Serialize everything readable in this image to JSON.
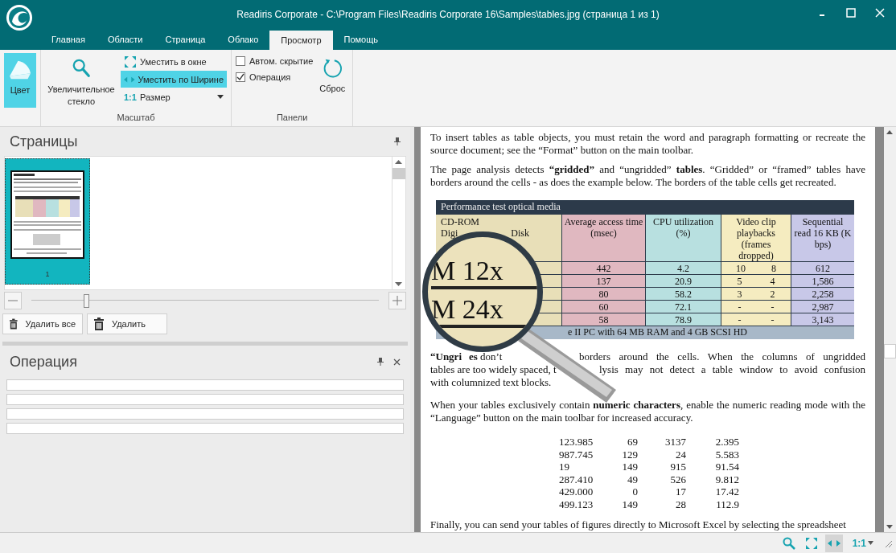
{
  "window": {
    "title": "Readiris Corporate - C:\\Program Files\\Readiris Corporate 16\\Samples\\tables.jpg (страница 1 из 1)"
  },
  "tabs": [
    {
      "label": "Главная",
      "selected": false
    },
    {
      "label": "Области",
      "selected": false
    },
    {
      "label": "Страница",
      "selected": false
    },
    {
      "label": "Облако",
      "selected": false
    },
    {
      "label": "Просмотр",
      "selected": true
    },
    {
      "label": "Помощь",
      "selected": false
    }
  ],
  "ribbon": {
    "color_button": {
      "label": "Цвет",
      "selected": true
    },
    "magnifier_button": {
      "label": "Увеличительное стекло"
    },
    "zoom_items": [
      {
        "kind": "fit",
        "label": "Уместить в окне",
        "selected": false
      },
      {
        "kind": "width",
        "label": "Уместить по Ширине",
        "selected": true
      },
      {
        "kind": "actual",
        "icon_text": "1:1",
        "label": "Размер",
        "selected": false
      }
    ],
    "zoom_group": "Масштаб",
    "panel_checks": [
      {
        "label": "Автом. скрытие",
        "checked": false
      },
      {
        "label": "Операция",
        "checked": true
      }
    ],
    "reset_button": "Сброс",
    "panels_group": "Панели"
  },
  "pages_panel": {
    "title": "Страницы",
    "pages": [
      {
        "number": "1",
        "selected": true
      }
    ],
    "zoom_slider": {
      "level": 0.15
    },
    "buttons": [
      "Удалить все",
      "Удалить"
    ]
  },
  "operation_panel": {
    "title": "Операция",
    "progress": [
      {
        "level": 0
      },
      {
        "level": 0
      },
      {
        "level": 0
      },
      {
        "level": 0
      }
    ]
  },
  "document": {
    "para1": "To insert tables as table objects, you must retain the word and paragraph formatting or recreate the source document; see the “Format” button on the main toolbar.",
    "para2": "The page analysis detects **“gridded”** and “ungridded” **tables**. “Gridded” or “framed” tables have borders around the cells - as does the example below. The borders of the table cells get recreated.",
    "table": {
      "title": "Performance test optical media",
      "first_header": [
        "CD-ROM",
        "Digi",
        "Disk"
      ],
      "headers": [
        "Average access time (msec)",
        "CPU utilization (%)",
        "Video clip playbacks (frames dropped)",
        "Sequential read 16 KB (K bps)"
      ],
      "rows": [
        {
          "access": "442",
          "cpu": "4.2",
          "frames": [
            "10",
            "8"
          ],
          "read": "612"
        },
        {
          "access": "137",
          "cpu": "20.9",
          "frames": [
            "5",
            "4"
          ],
          "read": "1,586"
        },
        {
          "access": "80",
          "cpu": "58.2",
          "frames": [
            "3",
            "2"
          ],
          "read": "2,258"
        },
        {
          "access": "60",
          "cpu": "72.1",
          "frames": [
            "-",
            "-"
          ],
          "read": "2,987"
        },
        {
          "access": "58",
          "cpu": "78.9",
          "frames": [
            "-",
            "-"
          ],
          "read": "3,143"
        }
      ],
      "footer": "e II PC with 64 MB RAM and 4 GB SCSI HD"
    },
    "para3_lines": [
      [
        {
          "text": "“Ungri",
          "bold": true
        },
        {
          "text": "**es** don’t",
          "bold": false
        },
        {
          "text": "borders around the cells. When the columns of ungridded",
          "bold": false
        }
      ],
      [
        {
          "text": "tables are too widely spaced, t",
          "bold": false
        },
        {
          "text": "lysis may not detect a table window to avoid confusion",
          "bold": false
        }
      ],
      [
        {
          "text": "with columnized text blocks.",
          "bold": false
        }
      ]
    ],
    "para4": "When your tables exclusively contain **numeric characters**, enable the numeric reading mode with the “Language” button on the main toolbar for increased accuracy.",
    "numbers": [
      [
        "123.985",
        "69",
        "3137",
        "2.395"
      ],
      [
        "987.745",
        "129",
        "24",
        "5.583"
      ],
      [
        "19",
        "149",
        "915",
        "91.54"
      ],
      [
        "287.410",
        "49",
        "526",
        "9.812"
      ],
      [
        "429.000",
        "0",
        "17",
        "17.42"
      ],
      [
        "499.123",
        "149",
        "28",
        "112.9"
      ]
    ],
    "para5": "Finally, you can send your tables of figures directly to Microsoft Excel by selecting the spreadsheet",
    "magnifier": {
      "lines": [
        "M 12x",
        "M 24x"
      ]
    }
  },
  "status_bar": {
    "tools": [
      {
        "kind": "search",
        "selected": false
      },
      {
        "kind": "fit",
        "selected": false
      },
      {
        "kind": "width",
        "selected": true
      }
    ],
    "zoom": "1:1"
  }
}
